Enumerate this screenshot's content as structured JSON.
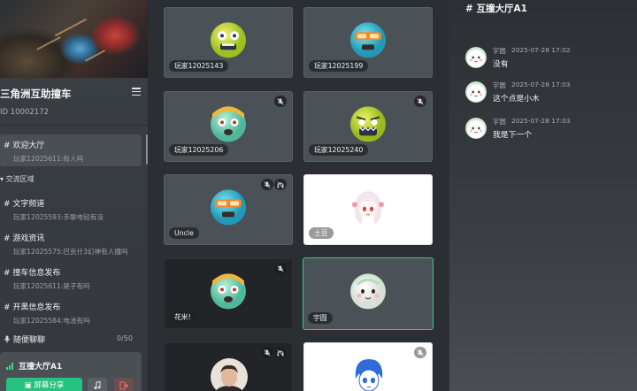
{
  "sidebar": {
    "server_name": "三角洲互助撞车",
    "server_id": "ID 10002172",
    "channels": [
      {
        "name": "# 欢迎大厅",
        "last": "玩家12025611:有人吗"
      },
      {
        "name": "# 文字频道",
        "last": "玩家12025593:手聊电钻有没"
      },
      {
        "name": "# 游戏资讯",
        "last": "玩家12025575:巴克什3幻神有人撞吗"
      },
      {
        "name": "# 撞车信息发布",
        "last": "玩家12025611:是子有吗"
      },
      {
        "name": "# 开黑信息发布",
        "last": "玩家12025584:电池有吗"
      }
    ],
    "category": "交流区域",
    "voice_channel": "随便聊聊",
    "voice_count": "0/50",
    "voice_panel": {
      "room": "互撞大厅A1",
      "share_label": "屏幕分享"
    }
  },
  "grid": {
    "tiles": [
      {
        "label": "玩家12025143",
        "muted": false,
        "deafened": false
      },
      {
        "label": "玩家12025199",
        "muted": false,
        "deafened": false
      },
      {
        "label": "玩家12025206",
        "muted": true,
        "deafened": false
      },
      {
        "label": "玩家12025240",
        "muted": true,
        "deafened": false
      },
      {
        "label": "Uncle",
        "muted": true,
        "deafened": true
      },
      {
        "label": "土豆",
        "muted": false,
        "deafened": false
      },
      {
        "label": "花米!",
        "muted": true,
        "deafened": false
      },
      {
        "label": "宇圆",
        "muted": false,
        "deafened": false,
        "speaking": true
      },
      {
        "label": "",
        "muted": true,
        "deafened": true
      },
      {
        "label": "",
        "muted": true,
        "deafened": false
      }
    ]
  },
  "chat": {
    "title": "# 互撞大厅A1",
    "messages": [
      {
        "user": "宇圆",
        "time": "2025-07-28 17:02",
        "text": "没有"
      },
      {
        "user": "宇圆",
        "time": "2025-07-28 17:03",
        "text": "这个点是小木"
      },
      {
        "user": "宇圆",
        "time": "2025-07-28 17:03",
        "text": "我是下一个"
      }
    ]
  },
  "colors": {
    "accent": "#26c281",
    "speaking_border": "#2fc98a"
  }
}
